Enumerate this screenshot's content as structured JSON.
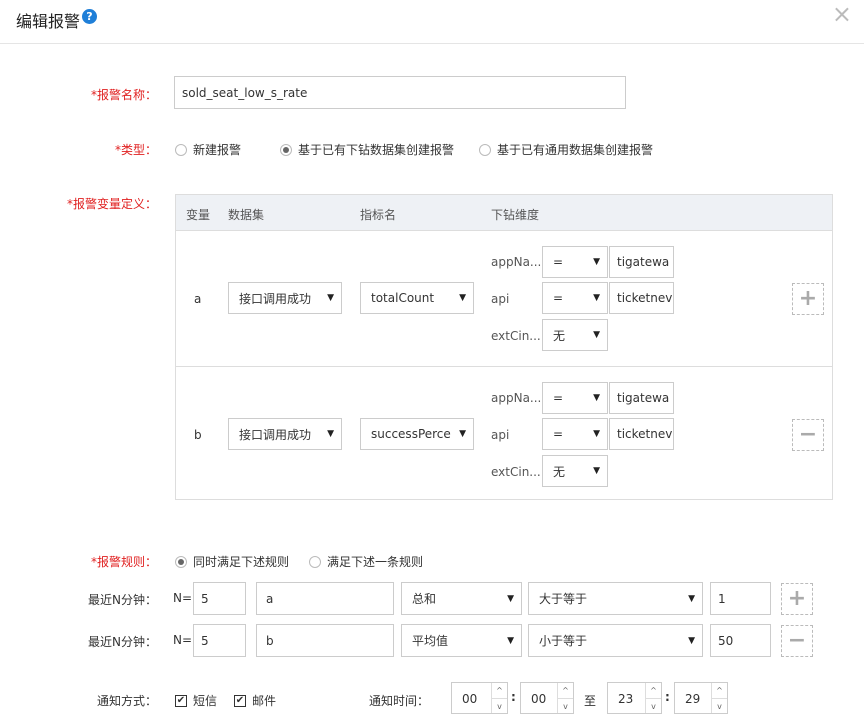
{
  "dialog": {
    "title": "编辑报警",
    "help_icon": "?",
    "close_icon": "×"
  },
  "form": {
    "name_label": "*报警名称：",
    "name_value": "sold_seat_low_s_rate",
    "type_label": "*类型：",
    "type_options": [
      {
        "label": "新建报警",
        "selected": false
      },
      {
        "label": "基于已有下钻数据集创建报警",
        "selected": true
      },
      {
        "label": "基于已有通用数据集创建报警",
        "selected": false
      }
    ],
    "var_label": "*报警变量定义："
  },
  "var_table": {
    "headers": [
      "变量",
      "数据集",
      "指标名",
      "下钻维度"
    ],
    "rows": [
      {
        "name": "a",
        "dataset": "接口调用成功",
        "metric": "totalCount",
        "dims": [
          {
            "label": "appNa...",
            "op": "=",
            "value": "tigatewa"
          },
          {
            "label": "api",
            "op": "=",
            "value": "ticketnev"
          },
          {
            "label": "extCin...",
            "op": "无",
            "value": ""
          }
        ],
        "action_icon": "+"
      },
      {
        "name": "b",
        "dataset": "接口调用成功",
        "metric": "successPerce",
        "dims": [
          {
            "label": "appNa...",
            "op": "=",
            "value": "tigatewa"
          },
          {
            "label": "api",
            "op": "=",
            "value": "ticketnev"
          },
          {
            "label": "extCin...",
            "op": "无",
            "value": ""
          }
        ],
        "action_icon": "−"
      }
    ]
  },
  "rules": {
    "label": "*报警规则：",
    "options": [
      {
        "label": "同时满足下述规则",
        "selected": true
      },
      {
        "label": "满足下述一条规则",
        "selected": false
      }
    ],
    "items": [
      {
        "label": "最近N分钟：",
        "n_prefix": "N=",
        "n": "5",
        "var": "a",
        "agg": "总和",
        "cmp": "大于等于",
        "threshold": "1",
        "action_icon": "+"
      },
      {
        "label": "最近N分钟：",
        "n_prefix": "N=",
        "n": "5",
        "var": "b",
        "agg": "平均值",
        "cmp": "小于等于",
        "threshold": "50",
        "action_icon": "−"
      }
    ]
  },
  "notify": {
    "label": "通知方式：",
    "sms": "短信",
    "email": "邮件",
    "check_mark": "✔",
    "time_label": "通知时间：",
    "start_h": "00",
    "start_m": "00",
    "to": "至",
    "end_h": "23",
    "end_m": "29",
    "colon": ":",
    "up_icon": "^",
    "down_icon": "v"
  },
  "caret_icon": "▼"
}
